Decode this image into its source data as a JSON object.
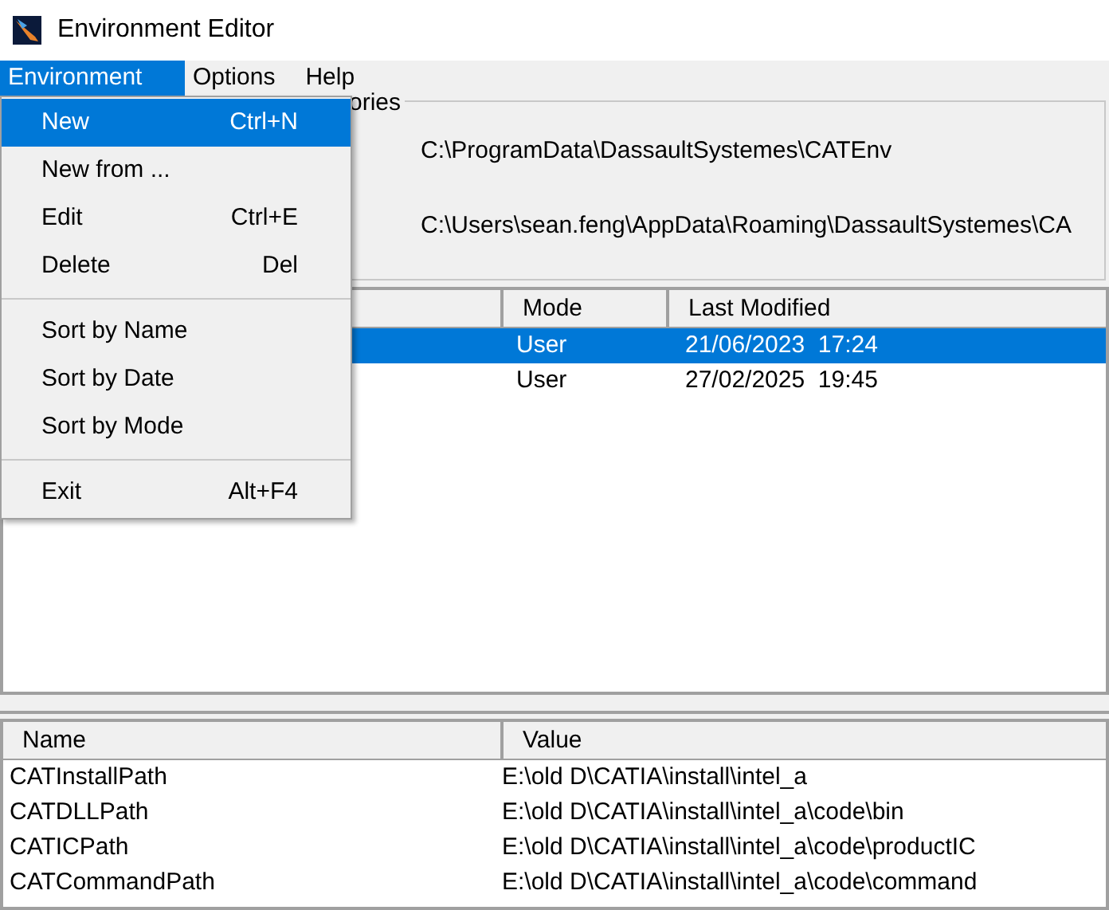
{
  "window": {
    "title": "Environment Editor"
  },
  "menubar": [
    {
      "label": "Environment",
      "selected": true
    },
    {
      "label": "Options",
      "selected": false
    },
    {
      "label": "Help",
      "selected": false
    }
  ],
  "menu": [
    {
      "kind": "item",
      "label": "New",
      "shortcut": "Ctrl+N",
      "selected": true
    },
    {
      "kind": "item",
      "label": "New from ...",
      "selected": false
    },
    {
      "kind": "item",
      "label": "Edit",
      "shortcut": "Ctrl+E",
      "selected": false
    },
    {
      "kind": "item",
      "label": "Delete",
      "shortcut": "Del",
      "selected": false
    },
    {
      "kind": "separator"
    },
    {
      "kind": "item",
      "label": "Sort by Name",
      "selected": false
    },
    {
      "kind": "item",
      "label": "Sort by Date",
      "selected": false
    },
    {
      "kind": "item",
      "label": "Sort by Mode",
      "selected": false
    },
    {
      "kind": "separator"
    },
    {
      "kind": "item",
      "label": "Exit",
      "shortcut": "Alt+F4",
      "selected": false
    }
  ],
  "directories": {
    "legend": "ories",
    "paths": [
      "C:\\ProgramData\\DassaultSystemes\\CATEnv",
      "C:\\Users\\sean.feng\\AppData\\Roaming\\DassaultSystemes\\CA"
    ]
  },
  "environments": {
    "columns": [
      "Mode",
      "Last Modified"
    ],
    "rows": [
      {
        "mode": "User",
        "modified": "21/06/2023  17:24",
        "selected": true
      },
      {
        "mode": "User",
        "modified": "27/02/2025  19:45",
        "selected": false
      }
    ]
  },
  "variables": {
    "columns": [
      "Name",
      "Value"
    ],
    "rows": [
      [
        "CATInstallPath",
        "E:\\old D\\CATIA\\install\\intel_a"
      ],
      [
        "CATDLLPath",
        "E:\\old D\\CATIA\\install\\intel_a\\code\\bin"
      ],
      [
        "CATICPath",
        "E:\\old D\\CATIA\\install\\intel_a\\code\\productIC"
      ],
      [
        "CATCommandPath",
        "E:\\old D\\CATIA\\install\\intel_a\\code\\command"
      ]
    ]
  }
}
